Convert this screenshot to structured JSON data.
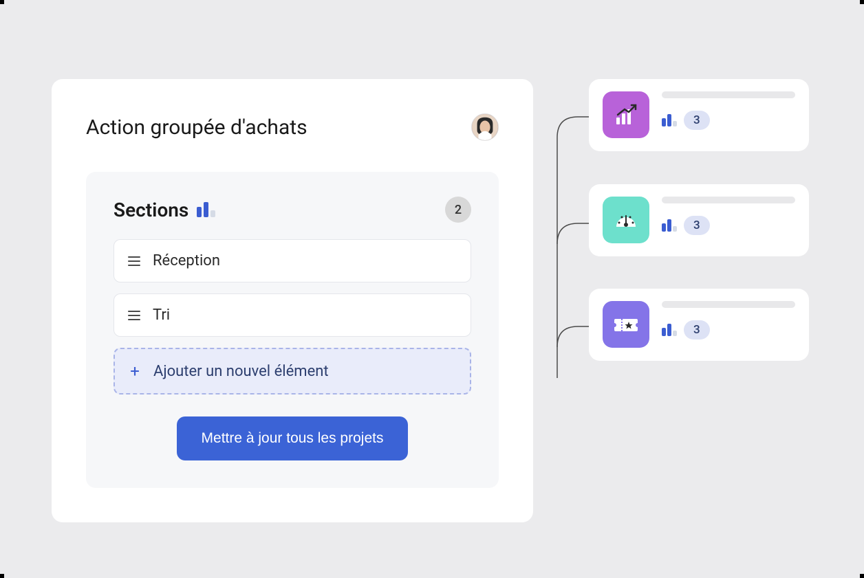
{
  "panel": {
    "title": "Action groupée d'achats"
  },
  "sections": {
    "title": "Sections",
    "count": "2",
    "items": [
      {
        "label": "Réception"
      },
      {
        "label": "Tri"
      }
    ],
    "add_label": "Ajouter un nouvel élément",
    "update_button": "Mettre à jour tous les projets"
  },
  "projects": [
    {
      "count": "3",
      "icon": "chart-growth-icon",
      "color": "#b862d9"
    },
    {
      "count": "3",
      "icon": "gauge-icon",
      "color": "#6de0cc"
    },
    {
      "count": "3",
      "icon": "ticket-icon",
      "color": "#8474e8"
    }
  ]
}
